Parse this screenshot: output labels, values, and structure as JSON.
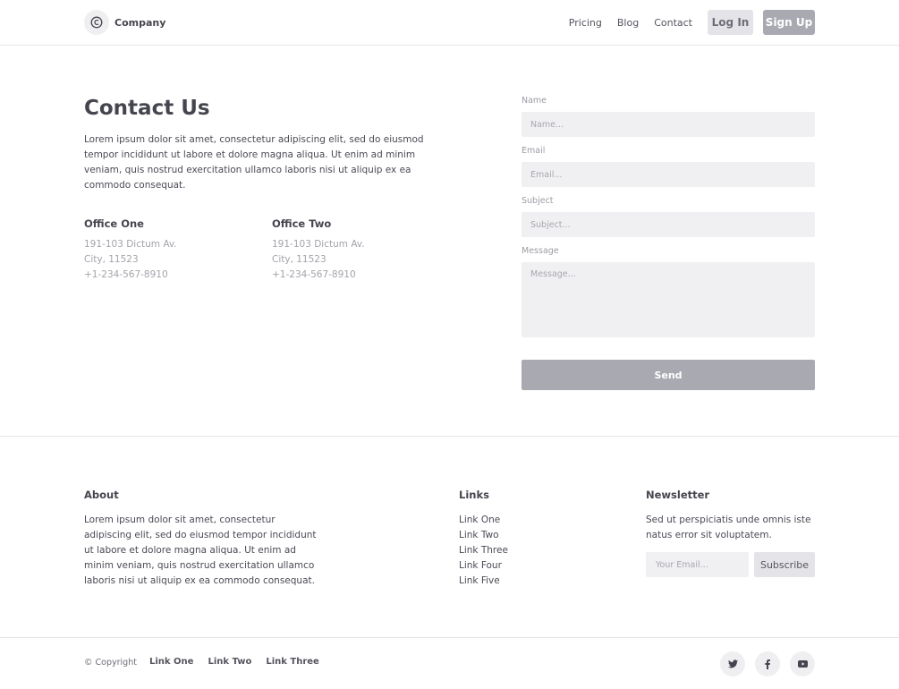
{
  "header": {
    "company_name": "Company",
    "logo_icon": "copyright-c-icon",
    "nav": [
      "Pricing",
      "Blog",
      "Contact"
    ],
    "login_label": "Log In",
    "signup_label": "Sign Up"
  },
  "contact": {
    "title": "Contact Us",
    "description": "Lorem ipsum dolor sit amet, consectetur adipiscing elit, sed do eiusmod tempor incididunt ut labore et dolore magna aliqua. Ut enim ad minim veniam, quis nostrud exercitation ullamco laboris nisi ut aliquip ex ea commodo consequat.",
    "offices": [
      {
        "title": "Office One",
        "address": "191-103 Dictum Av.",
        "city": "City, 11523",
        "phone": "+1-234-567-8910"
      },
      {
        "title": "Office Two",
        "address": "191-103 Dictum Av.",
        "city": "City, 11523",
        "phone": "+1-234-567-8910"
      }
    ]
  },
  "form": {
    "name_label": "Name",
    "name_placeholder": "Name...",
    "email_label": "Email",
    "email_placeholder": "Email...",
    "subject_label": "Subject",
    "subject_placeholder": "Subject...",
    "message_label": "Message",
    "message_placeholder": "Message...",
    "send_label": "Send"
  },
  "footer": {
    "about_title": "About",
    "about_text": "Lorem ipsum dolor sit amet, consectetur adipiscing elit, sed do eiusmod tempor incididunt ut labore et dolore magna aliqua. Ut enim ad minim veniam, quis nostrud exercitation ullamco laboris nisi ut aliquip ex ea commodo consequat.",
    "links_title": "Links",
    "links": [
      "Link One",
      "Link Two",
      "Link Three",
      "Link Four",
      "Link Five"
    ],
    "newsletter_title": "Newsletter",
    "newsletter_text": "Sed ut perspiciatis unde omnis iste natus error sit voluptatem.",
    "email_placeholder": "Your Email...",
    "subscribe_label": "Subscribe",
    "copyright": "© Copyright",
    "bottom_links": [
      "Link One",
      "Link Two",
      "Link Three"
    ],
    "social_icons": [
      "twitter-icon",
      "facebook-icon",
      "youtube-icon"
    ]
  },
  "colors": {
    "accent_button": "#a9a9b2",
    "input_background": "#f0f0f3",
    "text": "#4a4a55",
    "muted_text": "#a3a3ab"
  }
}
